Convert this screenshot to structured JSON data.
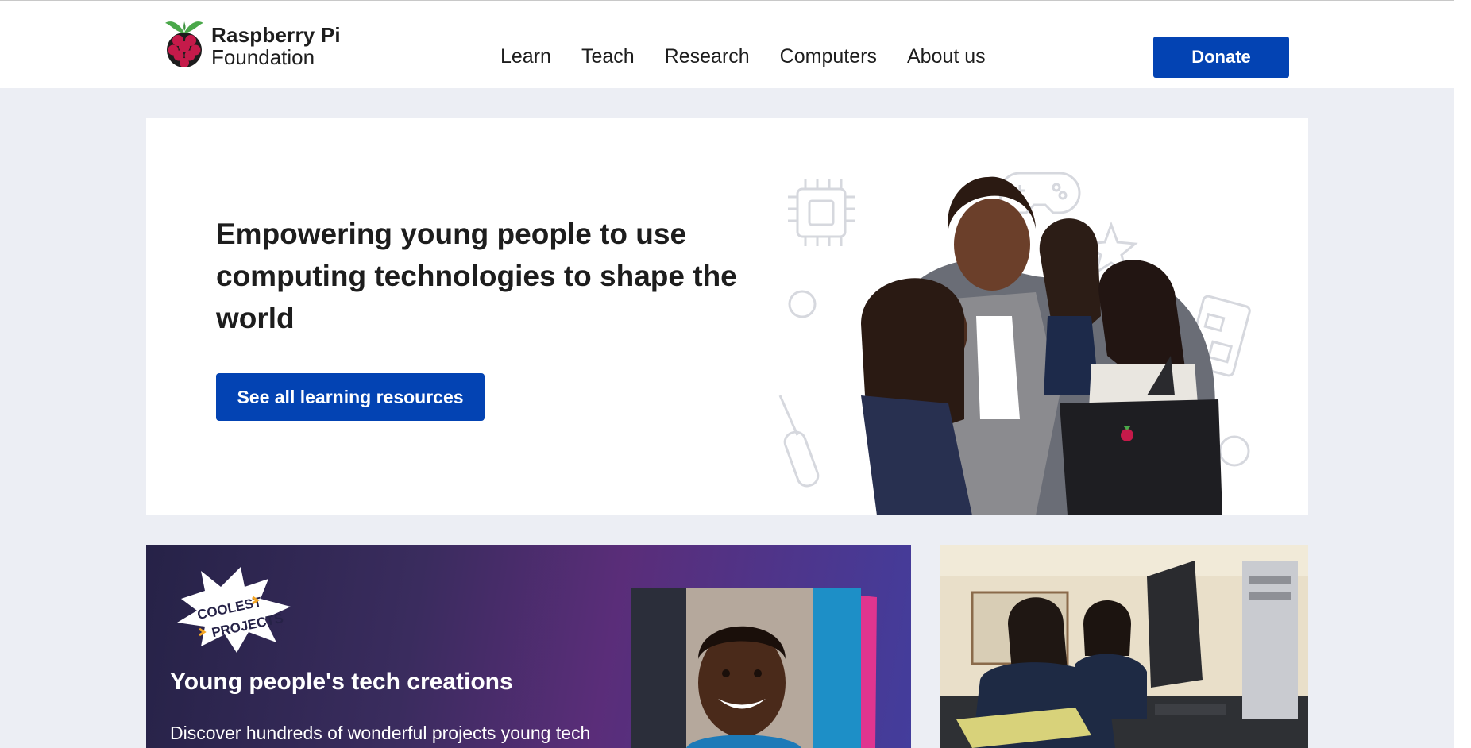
{
  "brand": {
    "name_line1": "Raspberry Pi",
    "name_line2": "Foundation"
  },
  "nav": {
    "items": [
      {
        "label": "Learn"
      },
      {
        "label": "Teach"
      },
      {
        "label": "Research"
      },
      {
        "label": "Computers"
      },
      {
        "label": "About us"
      }
    ]
  },
  "header": {
    "donate_label": "Donate"
  },
  "hero": {
    "title": "Empowering young people to use computing technologies to shape the world",
    "cta_label": "See all learning resources"
  },
  "cards": {
    "coolest_projects": {
      "logo_text_line1": "COOLEST",
      "logo_text_line2": "PROJECTS",
      "title": "Young people's tech creations",
      "description": "Discover hundreds of wonderful projects young tech"
    }
  },
  "colors": {
    "brand_blue": "#0343b3",
    "page_background": "#eceef4",
    "raspberry_red": "#c51a4a",
    "leaf_green": "#4aa84a"
  }
}
